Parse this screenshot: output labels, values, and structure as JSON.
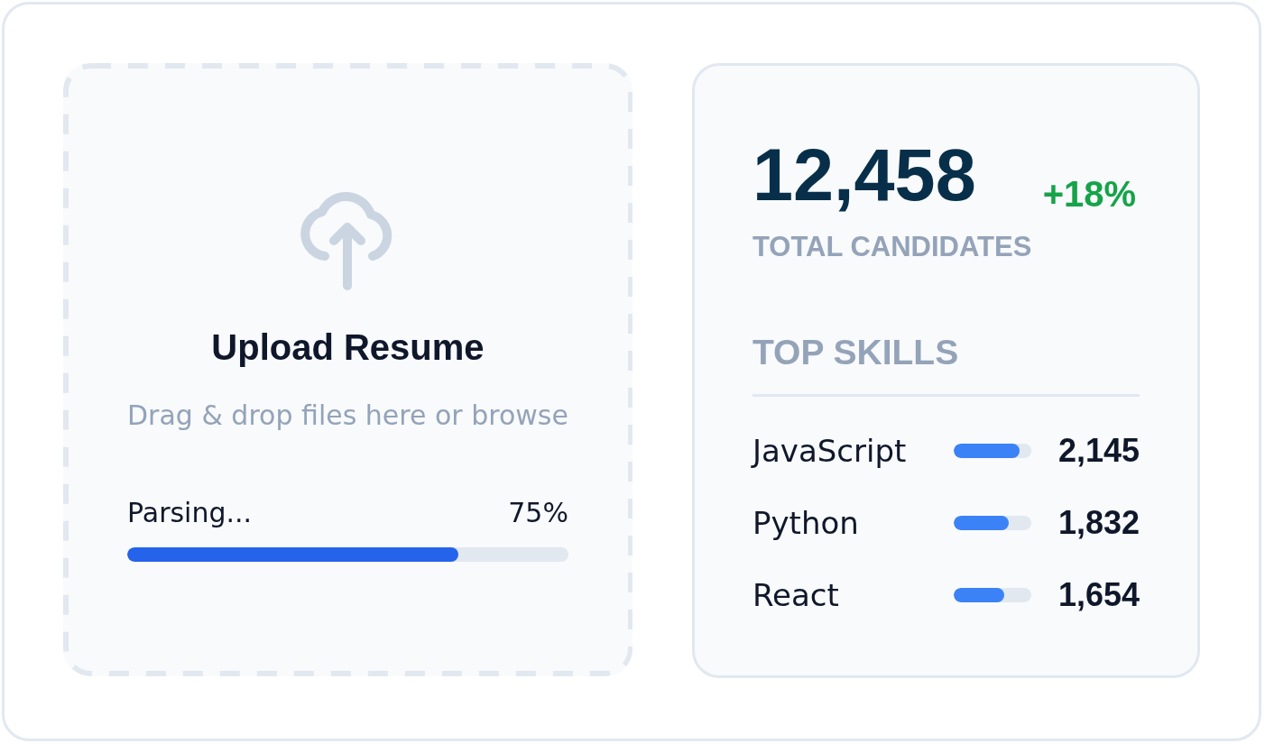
{
  "upload": {
    "title": "Upload Resume",
    "hint": "Drag & drop files here or browse",
    "progress": {
      "label": "Parsing...",
      "reading": "75%",
      "level": 0.75
    }
  },
  "stats": {
    "total": {
      "value": "12,458",
      "change": "+18%",
      "label": "TOTAL CANDIDATES"
    },
    "top_skills": {
      "title": "TOP SKILLS",
      "skills": [
        {
          "name": "JavaScript",
          "level": 0.85,
          "count": "2,145"
        },
        {
          "name": "Python",
          "level": 0.71,
          "count": "1,832"
        },
        {
          "name": "React",
          "level": 0.65,
          "count": "1,654"
        }
      ]
    }
  }
}
